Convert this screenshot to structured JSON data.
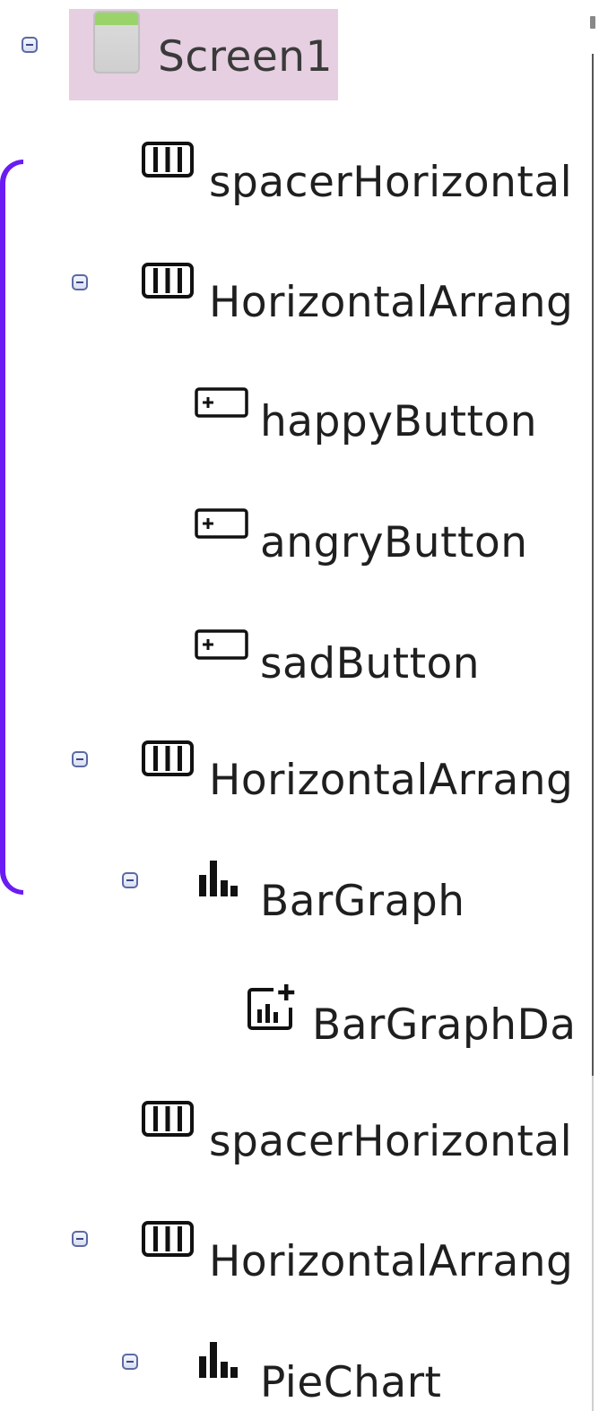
{
  "tree": {
    "root": {
      "label": "Screen1",
      "collapsed": false
    },
    "items": [
      {
        "label": "spacerHorizontal",
        "icon": "horizontal-arrangement-icon"
      },
      {
        "label": "HorizontalArrang",
        "icon": "horizontal-arrangement-icon"
      },
      {
        "label": "happyButton",
        "icon": "button-icon"
      },
      {
        "label": "angryButton",
        "icon": "button-icon"
      },
      {
        "label": "sadButton",
        "icon": "button-icon"
      },
      {
        "label": "HorizontalArrang",
        "icon": "horizontal-arrangement-icon"
      },
      {
        "label": "BarGraph",
        "icon": "chart-icon"
      },
      {
        "label": "BarGraphDa",
        "icon": "chart-data-icon"
      },
      {
        "label": "spacerHorizontal",
        "icon": "horizontal-arrangement-icon"
      },
      {
        "label": "HorizontalArrang",
        "icon": "horizontal-arrangement-icon"
      },
      {
        "label": "PieChart",
        "icon": "chart-icon"
      }
    ]
  },
  "colors": {
    "selected_background": "#e5cfe0",
    "bracket": "#6a1cf2",
    "toggle_border": "#5b6aa3",
    "text": "#1f1f1f"
  }
}
